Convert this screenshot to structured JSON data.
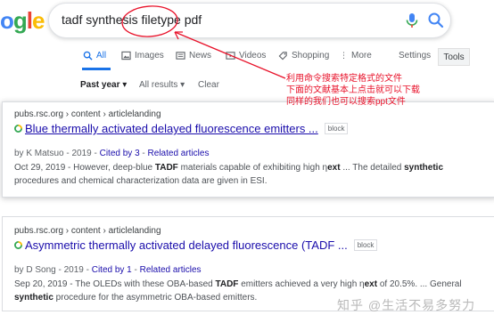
{
  "logo": {
    "text_visible": "ogle"
  },
  "search": {
    "query": "tadf synthesis filetype pdf"
  },
  "tabs": [
    {
      "label": "All",
      "icon": "search-icon"
    },
    {
      "label": "Images",
      "icon": "image-icon"
    },
    {
      "label": "News",
      "icon": "news-icon"
    },
    {
      "label": "Videos",
      "icon": "video-icon"
    },
    {
      "label": "Shopping",
      "icon": "tag-icon"
    },
    {
      "label": "More",
      "icon": "more-dots-icon"
    }
  ],
  "settings_label": "Settings",
  "tools_label": "Tools",
  "filters": {
    "time": "Past year ▾",
    "results": "All results ▾",
    "clear": "Clear"
  },
  "annotation": {
    "lines": [
      "利用命令搜索特定格式的文件",
      "下面的文献基本上点击就可以下载",
      "同样的我们也可以搜索ppt文件"
    ],
    "color": "#e8122a"
  },
  "results": [
    {
      "breadcrumb": "pubs.rsc.org › content › articlelanding",
      "title": "Blue thermally activated delayed fluorescence emitters ...",
      "block": "block",
      "author": "by K Matsuo - 2019 - ",
      "cited": "Cited by 3",
      "sep": " - ",
      "related": "Related articles",
      "snippet": {
        "l1a": "Oct 29, 2019 - However, deep-blue ",
        "l1b": "TADF",
        "l1c": " materials capable of exhibiting high η",
        "l1d": "ext",
        "l1e": " ... The detailed ",
        "l1f": "synthetic",
        "l2": "procedures and chemical characterization data are given in ESI."
      }
    },
    {
      "breadcrumb": "pubs.rsc.org › content › articlelanding",
      "title": "Asymmetric thermally activated delayed fluorescence (TADF ...",
      "block": "block",
      "author": "by D Song - 2019 - ",
      "cited": "Cited by 1",
      "sep": " - ",
      "related": "Related articles",
      "snippet": {
        "l1a": "Sep 20, 2019 - The OLEDs with these OBA-based ",
        "l1b": "TADF",
        "l1c": " emitters achieved a very high η",
        "l1d": "ext",
        "l1e": " of 20.5%. ... General",
        "l2a": "synthetic",
        "l2b": " procedure for the asymmetric OBA-based emitters."
      }
    }
  ],
  "watermark": "知乎 @生活不易多努力"
}
